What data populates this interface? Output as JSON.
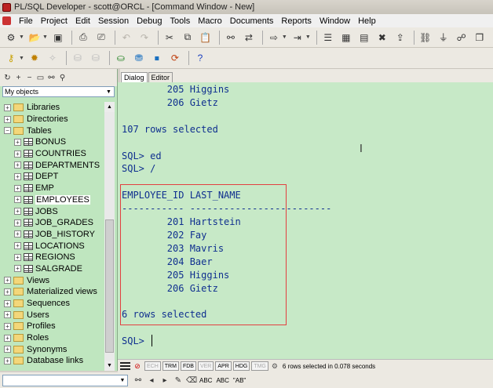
{
  "window": {
    "title": "PL/SQL Developer - scott@ORCL - [Command Window - New]"
  },
  "menu": [
    "File",
    "Project",
    "Edit",
    "Session",
    "Debug",
    "Tools",
    "Macro",
    "Documents",
    "Reports",
    "Window",
    "Help"
  ],
  "toolbar1": [
    {
      "icon": "new-icon",
      "dd": true
    },
    {
      "icon": "open-folder-icon",
      "dd": true
    },
    {
      "icon": "save-icon"
    },
    {
      "icon": "print-icon"
    },
    {
      "icon": "print-preview-icon"
    },
    {
      "icon": "undo-icon",
      "disabled": true
    },
    {
      "icon": "redo-icon",
      "disabled": true
    },
    {
      "icon": "cut-icon"
    },
    {
      "icon": "copy-icon"
    },
    {
      "icon": "paste-icon"
    },
    {
      "icon": "find-icon"
    },
    {
      "icon": "find-replace-icon"
    },
    {
      "icon": "execute-icon",
      "dd": true
    },
    {
      "icon": "step-icon",
      "dd": true
    },
    {
      "icon": "list-icon"
    },
    {
      "icon": "table-icon"
    },
    {
      "icon": "grid-icon"
    },
    {
      "icon": "delete-icon"
    },
    {
      "icon": "export-icon"
    },
    {
      "icon": "connect-icon"
    },
    {
      "icon": "plug-icon"
    },
    {
      "icon": "session-icon"
    },
    {
      "icon": "window-list-icon"
    }
  ],
  "toolbar2": [
    {
      "icon": "key-icon",
      "dd": true
    },
    {
      "icon": "gear-icon"
    },
    {
      "icon": "wand-icon",
      "disabled": true
    },
    {
      "icon": "db-icon",
      "disabled": true
    },
    {
      "icon": "db2-icon",
      "disabled": true
    },
    {
      "icon": "commit-icon"
    },
    {
      "icon": "rollback-icon"
    },
    {
      "icon": "stop-icon"
    },
    {
      "icon": "refresh-icon"
    },
    {
      "icon": "help-icon"
    }
  ],
  "browser": {
    "filter": "My objects",
    "tree": [
      {
        "label": "Libraries",
        "level": 0,
        "type": "folder",
        "exp": "+"
      },
      {
        "label": "Directories",
        "level": 0,
        "type": "folder",
        "exp": "+"
      },
      {
        "label": "Tables",
        "level": 0,
        "type": "folder",
        "exp": "−"
      },
      {
        "label": "BONUS",
        "level": 1,
        "type": "table",
        "exp": "+"
      },
      {
        "label": "COUNTRIES",
        "level": 1,
        "type": "table",
        "exp": "+"
      },
      {
        "label": "DEPARTMENTS",
        "level": 1,
        "type": "table",
        "exp": "+"
      },
      {
        "label": "DEPT",
        "level": 1,
        "type": "table",
        "exp": "+"
      },
      {
        "label": "EMP",
        "level": 1,
        "type": "table",
        "exp": "+"
      },
      {
        "label": "EMPLOYEES",
        "level": 1,
        "type": "table",
        "exp": "+",
        "selected": true
      },
      {
        "label": "JOBS",
        "level": 1,
        "type": "table",
        "exp": "+"
      },
      {
        "label": "JOB_GRADES",
        "level": 1,
        "type": "table",
        "exp": "+"
      },
      {
        "label": "JOB_HISTORY",
        "level": 1,
        "type": "table",
        "exp": "+"
      },
      {
        "label": "LOCATIONS",
        "level": 1,
        "type": "table",
        "exp": "+"
      },
      {
        "label": "REGIONS",
        "level": 1,
        "type": "table",
        "exp": "+"
      },
      {
        "label": "SALGRADE",
        "level": 1,
        "type": "table",
        "exp": "+"
      },
      {
        "label": "Views",
        "level": 0,
        "type": "folder",
        "exp": "+"
      },
      {
        "label": "Materialized views",
        "level": 0,
        "type": "folder",
        "exp": "+"
      },
      {
        "label": "Sequences",
        "level": 0,
        "type": "folder",
        "exp": "+"
      },
      {
        "label": "Users",
        "level": 0,
        "type": "folder",
        "exp": "+"
      },
      {
        "label": "Profiles",
        "level": 0,
        "type": "folder",
        "exp": "+"
      },
      {
        "label": "Roles",
        "level": 0,
        "type": "folder",
        "exp": "+"
      },
      {
        "label": "Synonyms",
        "level": 0,
        "type": "folder",
        "exp": "+"
      },
      {
        "label": "Database links",
        "level": 0,
        "type": "folder",
        "exp": "+"
      }
    ]
  },
  "tabs": [
    "Dialog",
    "Editor"
  ],
  "console": {
    "lines": [
      "        205 Higgins",
      "        206 Gietz",
      "",
      "107 rows selected",
      "",
      "SQL> ed",
      "SQL> /",
      "",
      "EMPLOYEE_ID LAST_NAME",
      "----------- -------------------------",
      "        201 Hartstein",
      "        202 Fay",
      "        203 Mavris",
      "        204 Baer",
      "        205 Higgins",
      "        206 Gietz",
      "",
      "6 rows selected",
      "",
      "SQL> "
    ]
  },
  "statusbar": {
    "indicators": [
      {
        "label": "ECH",
        "disabled": true
      },
      {
        "label": "TRM"
      },
      {
        "label": "FDB"
      },
      {
        "label": "VER",
        "disabled": true
      },
      {
        "label": "APR"
      },
      {
        "label": "HDG"
      },
      {
        "label": "TMG",
        "disabled": true
      }
    ],
    "message": "6 rows selected in 0.078 seconds"
  },
  "findbar": {
    "value": "",
    "buttons": [
      "binoculars-icon",
      "find-prev-icon",
      "find-next-icon",
      "highlight-icon",
      "clear-icon"
    ],
    "text_buttons": [
      "ABC",
      "ABC",
      "\"AB\""
    ]
  }
}
